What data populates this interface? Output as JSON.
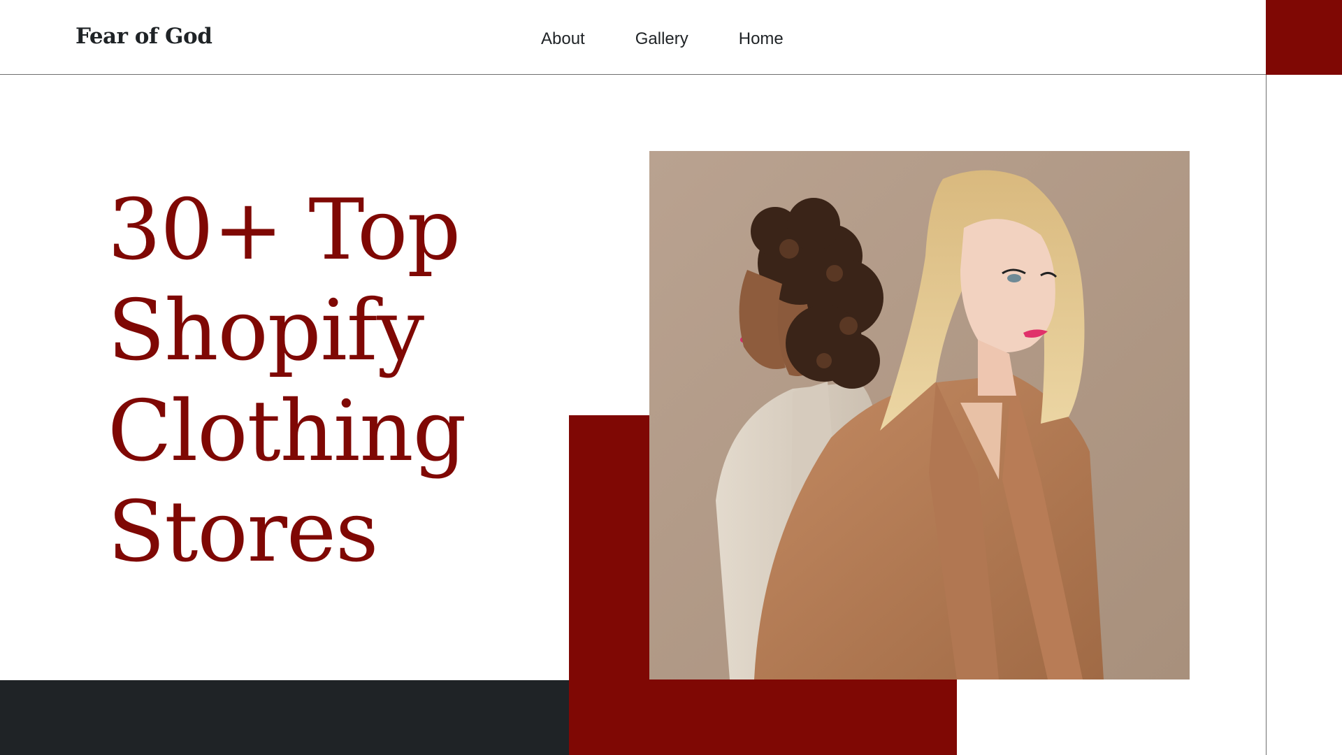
{
  "header": {
    "brand": "Fear of God",
    "nav": [
      {
        "label": "About"
      },
      {
        "label": "Gallery"
      },
      {
        "label": "Home"
      }
    ]
  },
  "hero": {
    "headline_lines": [
      "30+ Top",
      "Shopify",
      "Clothing",
      "Stores"
    ]
  },
  "colors": {
    "accent": "#7f0804",
    "dark": "#1f2326",
    "photo_background": "#b59e8c"
  }
}
